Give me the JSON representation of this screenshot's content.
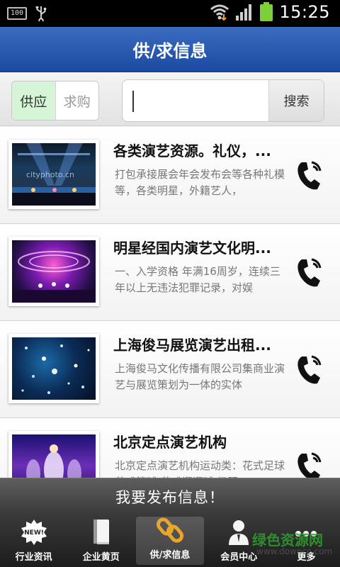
{
  "status_bar": {
    "battery_small_label": "100",
    "time": "15:25",
    "icons": [
      "usb-icon",
      "wifi-icon",
      "signal-icon",
      "battery-icon"
    ]
  },
  "header": {
    "title": "供/求信息"
  },
  "filter": {
    "segments": [
      {
        "label": "供应",
        "selected": true
      },
      {
        "label": "求购",
        "selected": false
      }
    ],
    "search": {
      "value": "",
      "button_label": "搜索"
    }
  },
  "list": {
    "items": [
      {
        "title": "各类演艺资源。礼仪，...",
        "desc": "打包承接展会年会发布会等各种礼模等，各类明星，外籍艺人，",
        "thumb_text": "cityphoto.cn"
      },
      {
        "title": "明星经国内演艺文化明...",
        "desc": "一、入学资格 年满16周岁，连续三年以上无违法犯罪记录，对娱"
      },
      {
        "title": "上海俊马展览演艺出租...",
        "desc": "上海俊马文化传播有限公司集商业演艺与展览策划为一体的实体"
      },
      {
        "title": "北京定点演艺机构",
        "desc": "北京定点演艺机构运动类：花式足球 花式篮球 花式溜溜球 极限"
      }
    ]
  },
  "publish_bar": {
    "label": "我要发布信息！"
  },
  "tab_bar": {
    "tabs": [
      {
        "label": "行业资讯",
        "badge": "NEW!",
        "active": false
      },
      {
        "label": "企业黄页",
        "active": false
      },
      {
        "label": "供/求信息",
        "active": true
      },
      {
        "label": "会员中心",
        "active": false
      },
      {
        "label": "更多",
        "active": false
      }
    ]
  },
  "watermark": {
    "text": "绿色资源网",
    "url": "www.downcc.com"
  },
  "colors": {
    "header_blue": "#1b4aa0",
    "segment_selected": "#d6f5d6",
    "publish_bar": "#4a4a4a",
    "tab_bar": "#2a2a2a"
  }
}
